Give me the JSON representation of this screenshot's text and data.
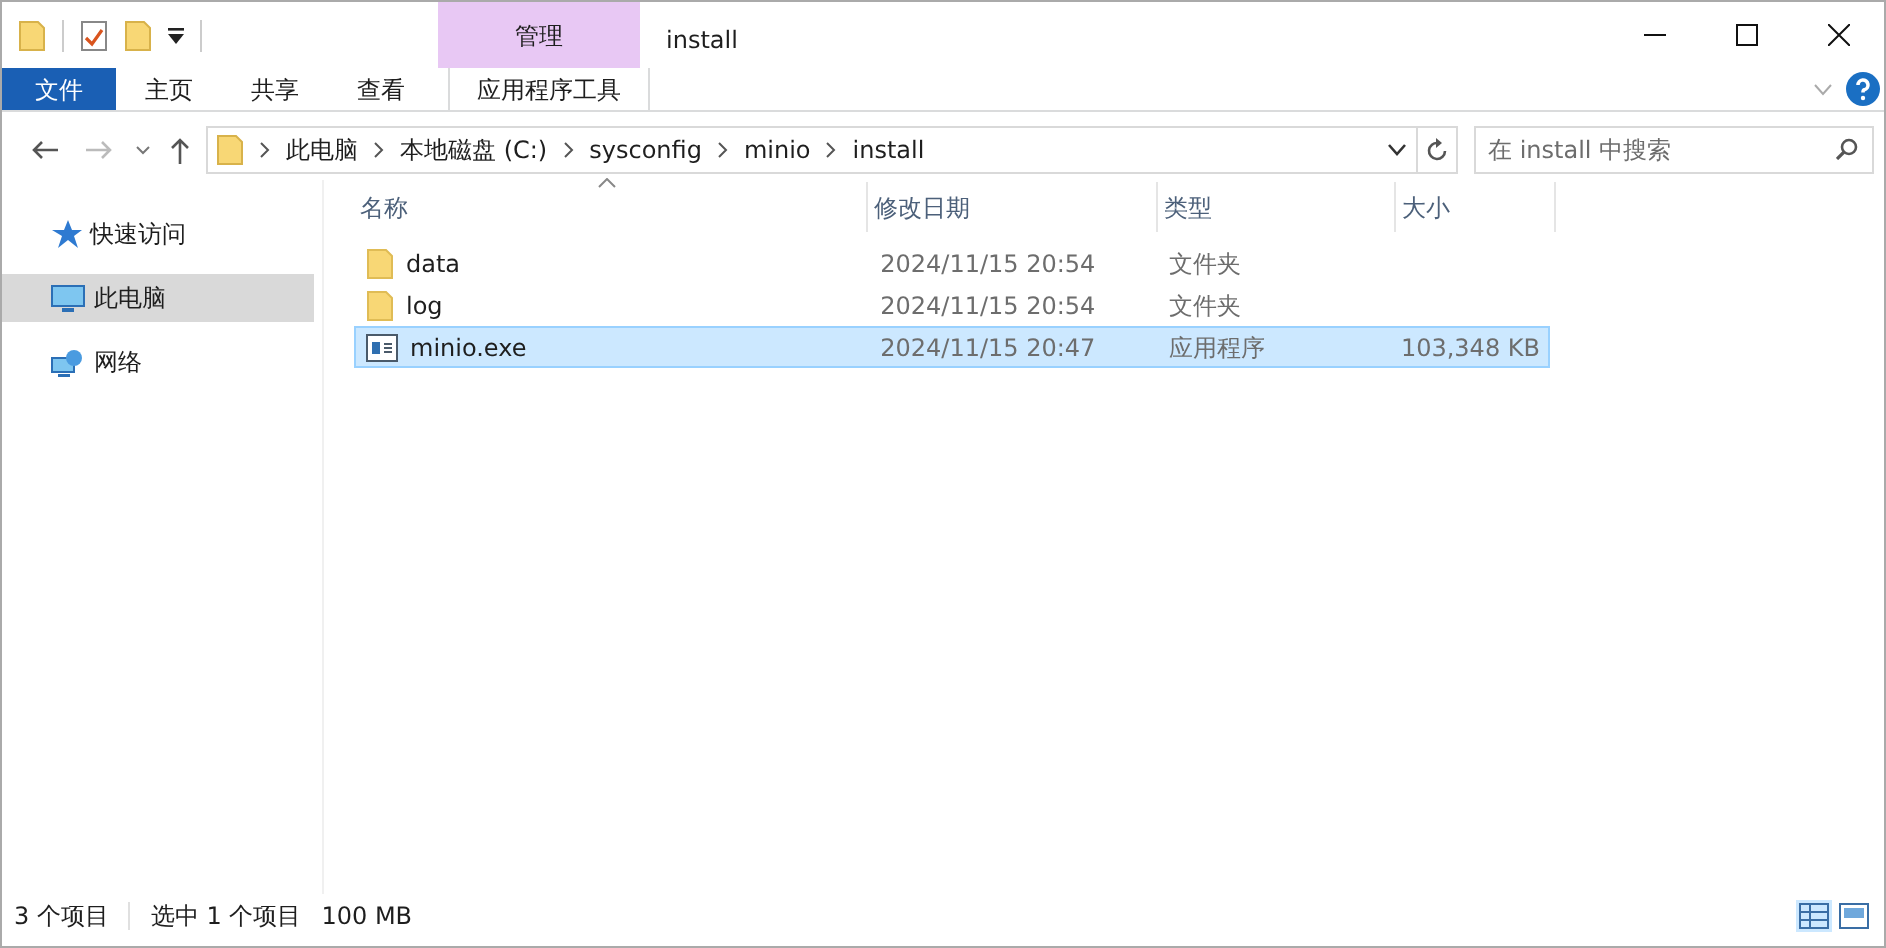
{
  "window": {
    "title": "install",
    "context_tab": "管理"
  },
  "ribbon_tabs": [
    {
      "label": "文件",
      "kind": "file",
      "selected": false
    },
    {
      "label": "主页",
      "kind": "tab",
      "selected": false
    },
    {
      "label": "共享",
      "kind": "tab",
      "selected": false
    },
    {
      "label": "查看",
      "kind": "tab",
      "selected": false
    },
    {
      "label": "应用程序工具",
      "kind": "context",
      "selected": false
    }
  ],
  "address": {
    "crumbs": [
      "此电脑",
      "本地磁盘 (C:)",
      "sysconfig",
      "minio",
      "install"
    ]
  },
  "search": {
    "placeholder": "在 install 中搜索"
  },
  "sidebar": {
    "items": [
      {
        "label": "快速访问",
        "kind": "star",
        "selected": false
      },
      {
        "label": "此电脑",
        "kind": "pc",
        "selected": true
      },
      {
        "label": "网络",
        "kind": "network",
        "selected": false
      }
    ]
  },
  "table": {
    "columns": [
      "名称",
      "修改日期",
      "类型",
      "大小"
    ],
    "rows": [
      {
        "name": "data",
        "kind": "folder",
        "date": "2024/11/15 20:54",
        "type": "文件夹",
        "size": "",
        "selected": false
      },
      {
        "name": "log",
        "kind": "folder",
        "date": "2024/11/15 20:54",
        "type": "文件夹",
        "size": "",
        "selected": false
      },
      {
        "name": "minio.exe",
        "kind": "app",
        "date": "2024/11/15 20:47",
        "type": "应用程序",
        "size": "103,348 KB",
        "selected": true
      }
    ]
  },
  "status_bar": {
    "count": "3 个项目",
    "selection": "选中 1 个项目",
    "size": "100 MB"
  }
}
